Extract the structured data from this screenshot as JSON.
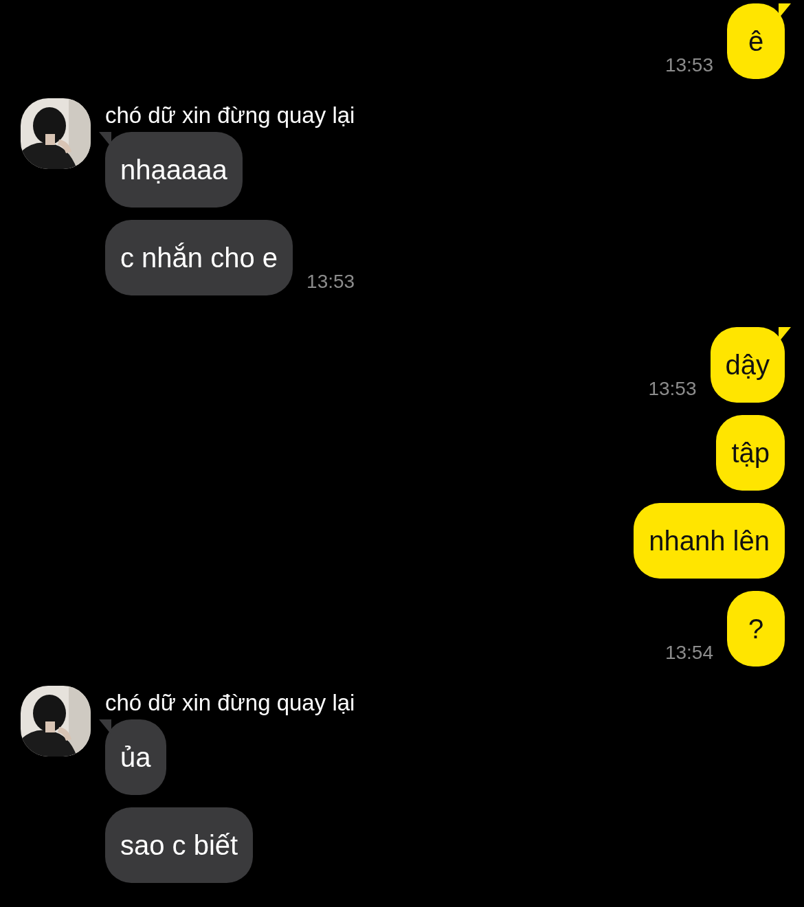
{
  "messages": [
    {
      "kind": "sent",
      "bubbles": [
        {
          "text": "ê",
          "time": "13:53"
        }
      ]
    },
    {
      "kind": "received",
      "sender": "chó dữ xin đừng quay lại",
      "bubbles": [
        {
          "text": "nhạaaaa"
        },
        {
          "text": "c nhắn cho e",
          "time": "13:53"
        }
      ]
    },
    {
      "kind": "sent",
      "bubbles": [
        {
          "text": "dậy",
          "time": "13:53"
        },
        {
          "text": "tập"
        },
        {
          "text": "nhanh lên"
        },
        {
          "text": "?",
          "time": "13:54"
        }
      ]
    },
    {
      "kind": "received",
      "sender": "chó dữ xin đừng quay lại",
      "bubbles": [
        {
          "text": "ủa"
        },
        {
          "text": "sao c biết"
        }
      ]
    }
  ]
}
